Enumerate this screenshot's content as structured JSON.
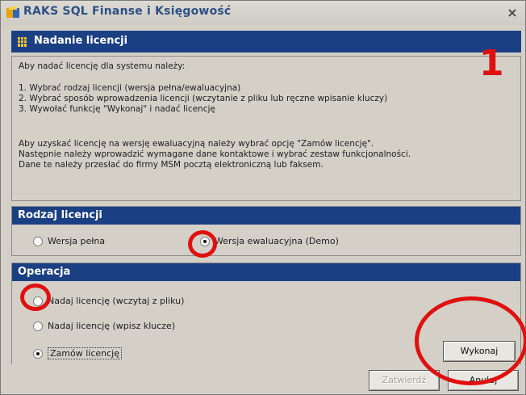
{
  "window": {
    "title": "RAKS SQL Finanse i Księgowość",
    "close_glyph": "×"
  },
  "header": {
    "title": "Nadanie licencji"
  },
  "info": {
    "intro": "Aby nadać licencję dla systemu należy:",
    "steps": [
      "1. Wybrać rodzaj licencji (wersja pełna/ewaluacyjna)",
      "2. Wybrać sposób wprowadzenia licencji (wczytanie z pliku lub ręczne wpisanie kluczy)",
      "3. Wywołać funkcję \"Wykonaj\" i nadać licencję"
    ],
    "eval_lines": [
      "Aby uzyskać licencję na wersję ewaluacyjną należy wybrać opcję \"Zamów licencję\".",
      "Następnie należy wprowadzić wymagane dane kontaktowe i wybrać zestaw funkcjonalności.",
      "Dane te należy przesłać do firmy MSM pocztą elektroniczną lub faksem."
    ]
  },
  "license_type": {
    "title": "Rodzaj licencji",
    "options": [
      {
        "label": "Wersja pełna",
        "checked": false
      },
      {
        "label": "Wersja ewaluacyjna (Demo)",
        "checked": true
      }
    ]
  },
  "operation": {
    "title": "Operacja",
    "options": [
      {
        "label": "Nadaj licencję (wczytaj z pliku)",
        "checked": false
      },
      {
        "label": "Nadaj licencję (wpisz klucze)",
        "checked": false
      },
      {
        "label": "Zamów licencję",
        "checked": true
      }
    ],
    "execute_label": "Wykonaj"
  },
  "footer": {
    "confirm_label": "Zatwierdź",
    "cancel_label": "Anuluj"
  },
  "annotation": {
    "number": "1",
    "color": "#e01010"
  },
  "colors": {
    "bar": "#1b3f83",
    "window_bg": "#d4d0c8"
  }
}
